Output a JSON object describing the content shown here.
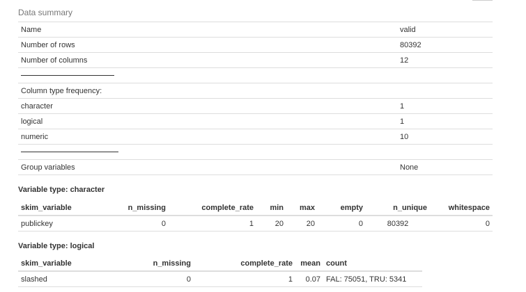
{
  "caption": "Data summary",
  "summary_rows": [
    {
      "label": "Name",
      "value": "valid"
    },
    {
      "label": "Number of rows",
      "value": "80392"
    },
    {
      "label": "Number of columns",
      "value": "12"
    },
    {
      "label": "",
      "value": ""
    },
    {
      "label": "Column type frequency:",
      "value": ""
    },
    {
      "label": "character",
      "value": "1"
    },
    {
      "label": "logical",
      "value": "1"
    },
    {
      "label": "numeric",
      "value": "10"
    },
    {
      "label": "",
      "value": ""
    },
    {
      "label": "Group variables",
      "value": "None"
    }
  ],
  "character_section": {
    "title": "Variable type: character",
    "headers": [
      "skim_variable",
      "n_missing",
      "complete_rate",
      "min",
      "max",
      "empty",
      "n_unique",
      "whitespace"
    ],
    "rows": [
      [
        "publickey",
        "0",
        "1",
        "20",
        "20",
        "0",
        "80392",
        "0"
      ]
    ]
  },
  "logical_section": {
    "title": "Variable type: logical",
    "headers": [
      "skim_variable",
      "n_missing",
      "complete_rate",
      "mean",
      "count"
    ],
    "rows": [
      [
        "slashed",
        "0",
        "1",
        "0.07",
        "FAL: 75051, TRU: 5341"
      ]
    ]
  }
}
